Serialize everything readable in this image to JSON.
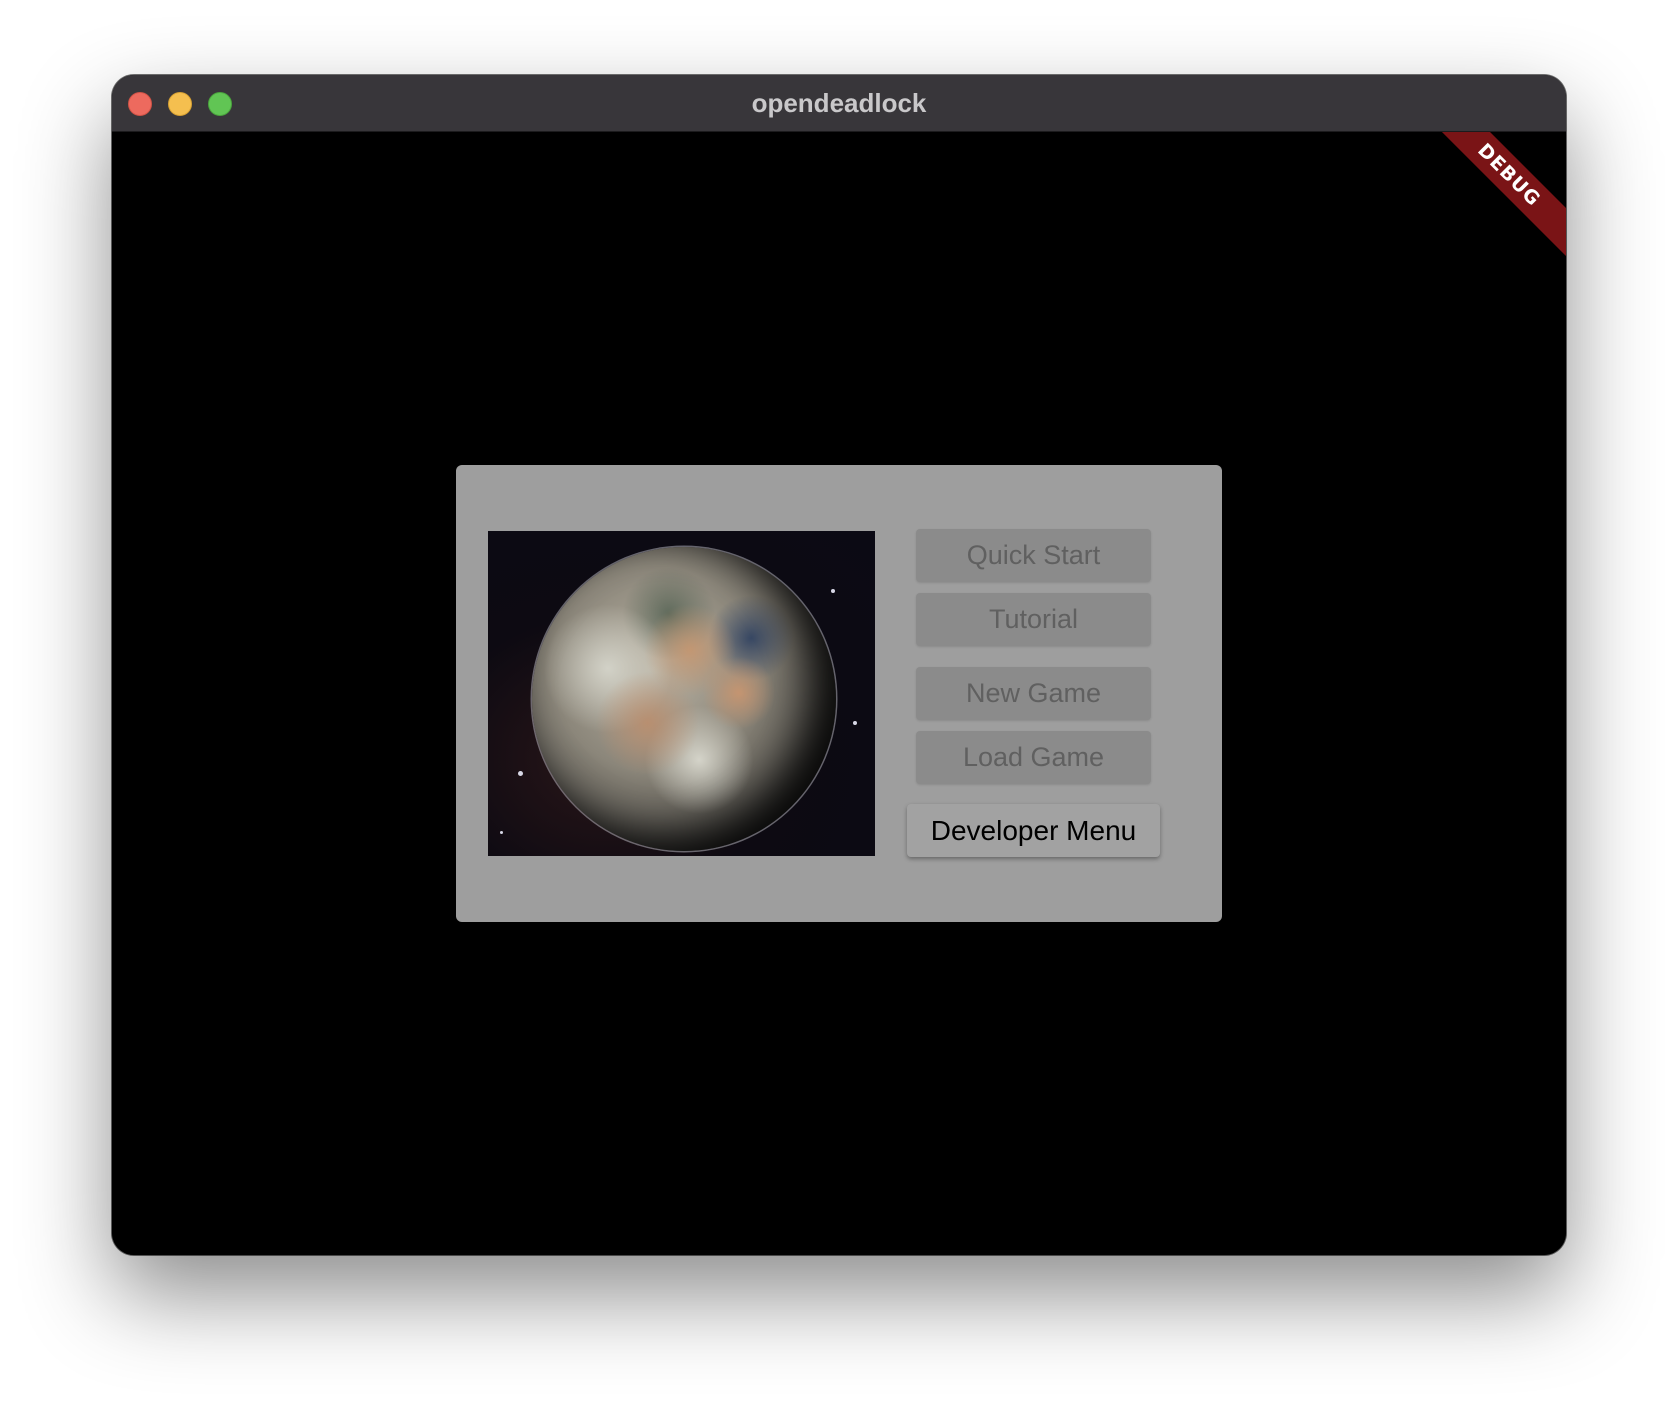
{
  "window": {
    "title": "opendeadlock",
    "controls": [
      "close",
      "minimize",
      "zoom"
    ]
  },
  "debug_banner": "DEBUG",
  "menu": {
    "image": {
      "icon": "planet-image",
      "description_visible": false
    },
    "buttons": {
      "quick_start": "Quick Start",
      "tutorial": "Tutorial",
      "new_game": "New Game",
      "load_game": "Load Game",
      "developer_menu": "Developer Menu"
    }
  },
  "colors": {
    "panel": "#9e9e9e",
    "disabled_button": "#8b8b8b",
    "disabled_text": "#606060",
    "debug_banner": "#7a1416",
    "background": "#000000"
  }
}
